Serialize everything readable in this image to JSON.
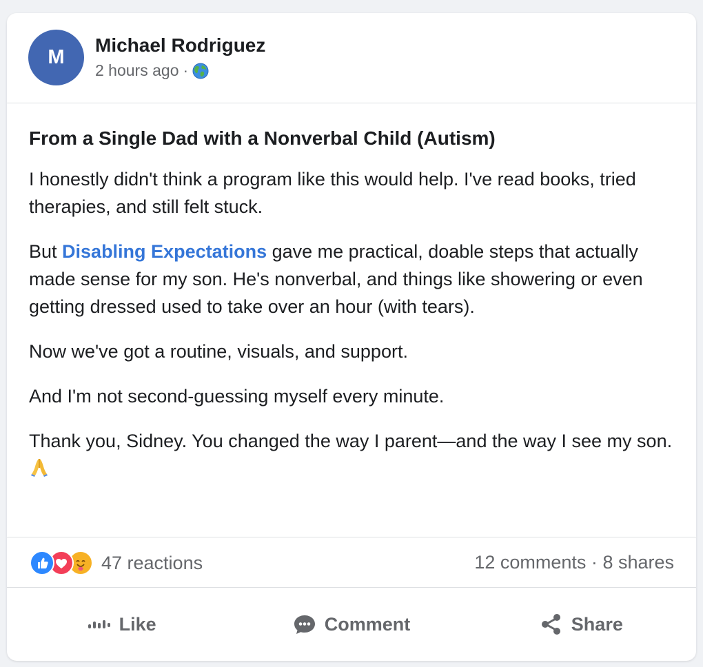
{
  "post": {
    "author": {
      "initial": "M",
      "name": "Michael Rodriguez",
      "avatar_color": "#4267b2"
    },
    "timestamp": "2 hours ago",
    "separator": "·",
    "audience_icon": "globe-icon",
    "title": "From a Single Dad with a Nonverbal Child (Autism)",
    "paragraphs": {
      "p1": "I honestly didn't think a program like this would help. I've read books, tried therapies, and still felt stuck.",
      "p2_before": "But ",
      "p2_link": "Disabling Expectations",
      "p2_after": " gave me practical, doable steps that actually made sense for my son. He's nonverbal, and things like showering or even getting dressed used to take over an hour (with tears).",
      "p3": "Now we've got a routine, visuals, and support.",
      "p4": "And I'm not second-guessing myself every minute.",
      "p5": "Thank you, Sidney. You changed the way I parent—and the way I see my son. "
    },
    "trailing_emoji": "folded-hands-icon",
    "link_color": "#3576d8"
  },
  "stats": {
    "reaction_icons": [
      "like-icon",
      "love-icon",
      "care-icon"
    ],
    "reactions": "47 reactions",
    "comments": "12 comments",
    "separator": "·",
    "shares": "8 shares"
  },
  "actions": {
    "like": "Like",
    "comment": "Comment",
    "share": "Share"
  }
}
